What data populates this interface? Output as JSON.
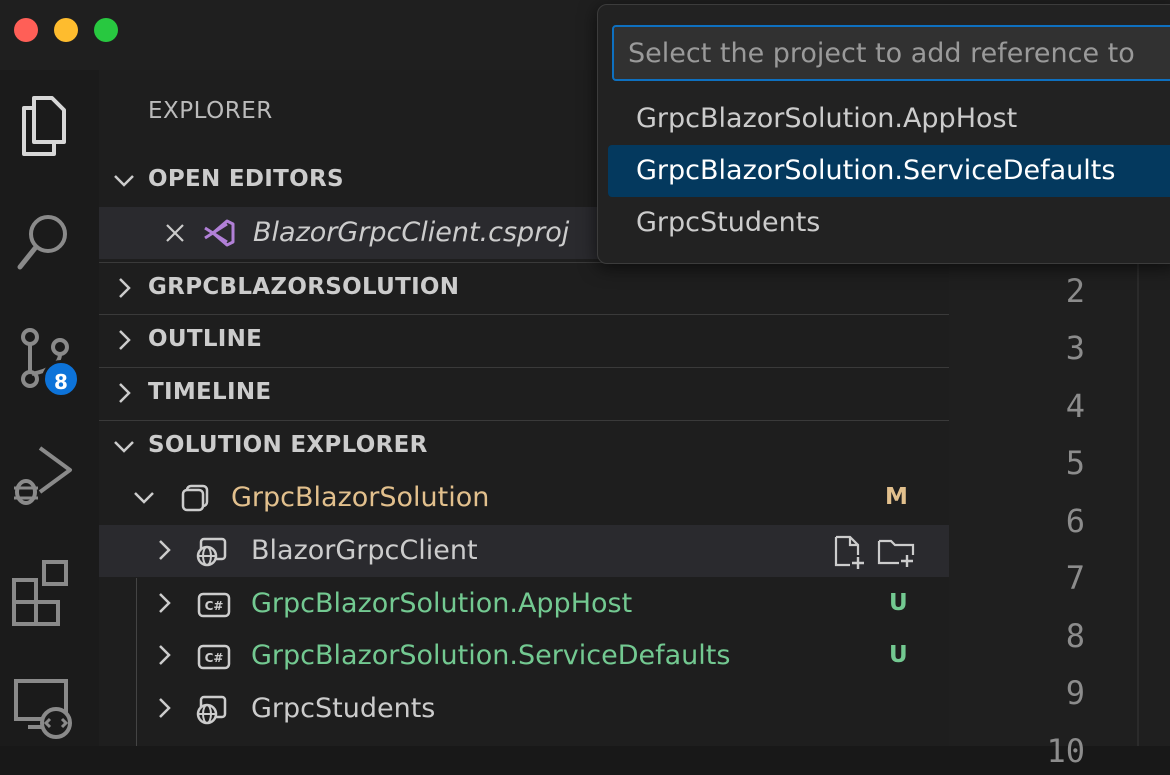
{
  "quick_pick": {
    "placeholder": "Select the project to add reference to",
    "items": [
      {
        "label": "GrpcBlazorSolution.AppHost",
        "selected": false
      },
      {
        "label": "GrpcBlazorSolution.ServiceDefaults",
        "selected": true
      },
      {
        "label": "GrpcStudents",
        "selected": false
      }
    ]
  },
  "activity_bar": {
    "items": [
      {
        "icon": "files-icon"
      },
      {
        "icon": "search-icon"
      },
      {
        "icon": "source-control-icon",
        "badge": "8"
      },
      {
        "icon": "run-debug-icon"
      },
      {
        "icon": "extensions-icon"
      },
      {
        "icon": "remote-explorer-icon"
      }
    ]
  },
  "explorer": {
    "title": "EXPLORER",
    "sections": {
      "open_editors": "OPEN EDITORS",
      "solution": "GRPCBLAZORSOLUTION",
      "outline": "OUTLINE",
      "timeline": "TIMELINE",
      "solution_explorer": "SOLUTION EXPLORER"
    },
    "open_editor_file": "BlazorGrpcClient.csproj",
    "tree": {
      "root": {
        "label": "GrpcBlazorSolution",
        "status": "M"
      },
      "projects": [
        {
          "label": "BlazorGrpcClient",
          "status": ""
        },
        {
          "label": "GrpcBlazorSolution.AppHost",
          "status": "U"
        },
        {
          "label": "GrpcBlazorSolution.ServiceDefaults",
          "status": "U"
        },
        {
          "label": "GrpcStudents",
          "status": ""
        }
      ]
    }
  },
  "editor": {
    "line_numbers": [
      "2",
      "3",
      "4",
      "5",
      "6",
      "7",
      "8",
      "9",
      "10"
    ]
  },
  "colors": {
    "accent": "#0e70c0",
    "selection": "#04395e",
    "modified": "#e2c08d",
    "untracked": "#73c991",
    "badge": "#0d73d9"
  }
}
